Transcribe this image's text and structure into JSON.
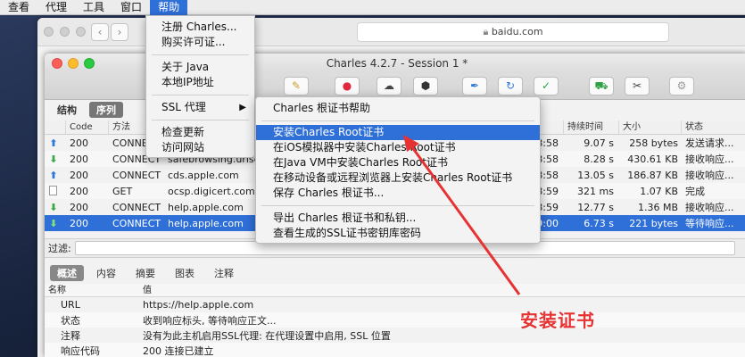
{
  "system_menu": [
    "查看",
    "代理",
    "工具",
    "窗口",
    "帮助"
  ],
  "browser": {
    "url": "baidu.com"
  },
  "charles": {
    "title": "Charles 4.2.7 - Session 1 *",
    "view_tabs": [
      "结构",
      "序列"
    ],
    "columns": [
      "Code",
      "方法",
      "",
      "",
      "持续时间",
      "大小",
      "状态"
    ],
    "rows": [
      {
        "dir": "up",
        "code": "200",
        "method": "CONNECT",
        "host": "",
        "time": "28:58",
        "duration": "9.07 s",
        "size": "258 bytes",
        "status": "发送请求..."
      },
      {
        "dir": "down",
        "code": "200",
        "method": "CONNECT",
        "host": "safebrowsing.urlse",
        "time": "28:58",
        "duration": "8.28 s",
        "size": "430.61 KB",
        "status": "接收响应..."
      },
      {
        "dir": "up",
        "code": "200",
        "method": "CONNECT",
        "host": "cds.apple.com",
        "time": "28:58",
        "duration": "13.05 s",
        "size": "186.87 KB",
        "status": "接收响应..."
      },
      {
        "dir": "doc",
        "code": "200",
        "method": "GET",
        "host": "ocsp.digicert.com",
        "time": "28:59",
        "duration": "321 ms",
        "size": "1.07 KB",
        "status": "完成"
      },
      {
        "dir": "down",
        "code": "200",
        "method": "CONNECT",
        "host": "help.apple.com",
        "time": "28:59",
        "duration": "12.77 s",
        "size": "1.36 MB",
        "status": "接收响应..."
      },
      {
        "dir": "down",
        "code": "200",
        "method": "CONNECT",
        "host": "help.apple.com",
        "time": "29:00",
        "duration": "6.73 s",
        "size": "221 bytes",
        "status": "等待响应..."
      }
    ],
    "filter_label": "过滤:",
    "sub_tabs": [
      "概述",
      "内容",
      "摘要",
      "图表",
      "注释"
    ],
    "props_header": {
      "name": "名称",
      "value": "值"
    },
    "props": [
      {
        "name": "URL",
        "value": "https://help.apple.com"
      },
      {
        "name": "状态",
        "value": "收到响应标头, 等待响应正文..."
      },
      {
        "name": "注释",
        "value": "没有为此主机启用SSL代理: 在代理设置中启用, SSL 位置"
      },
      {
        "name": "响应代码",
        "value": "200 连接已建立"
      }
    ]
  },
  "help_menu": {
    "items": [
      "注册 Charles...",
      "购买许可证...",
      "关于 Java",
      "本地IP地址",
      "SSL 代理",
      "检查更新",
      "访问网站"
    ],
    "submenu_arrow": "▶"
  },
  "ssl_submenu": {
    "items": [
      "Charles 根证书帮助",
      "安装Charles Root证书",
      "在iOS模拟器中安装Charles Root证书",
      "在Java VM中安装Charles Root证书",
      "在移动设备或远程浏览器上安装Charles Root证书",
      "保存 Charles 根证书...",
      "导出 Charles 根证书和私钥...",
      "查看生成的SSL证书密钥库密码"
    ]
  },
  "annotation": "安装证书",
  "colors": {
    "highlight": "#2f6fd8",
    "annotation": "#e63232"
  }
}
